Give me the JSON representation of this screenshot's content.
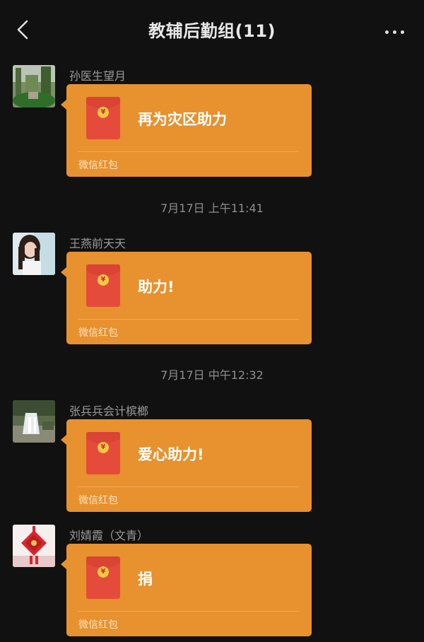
{
  "header": {
    "title": "教辅后勤组(11)",
    "back_icon": "chevron-left-icon",
    "more_icon": "more-horizontal-icon"
  },
  "messages": [
    {
      "sender": "孙医生望月",
      "avatar": "avatar-garden-photo",
      "red_packet": {
        "text": "再为灾区助力",
        "label": "微信红包",
        "coin": "¥"
      }
    },
    {
      "sender": "王燕前天天",
      "avatar": "avatar-girl-photo",
      "red_packet": {
        "text": "助力!",
        "label": "微信红包",
        "coin": "¥"
      }
    },
    {
      "sender": "张兵兵会计槟榔",
      "avatar": "avatar-waterfall-photo",
      "red_packet": {
        "text": "爱心助力!",
        "label": "微信红包",
        "coin": "¥"
      }
    },
    {
      "sender": "刘婧霞（文青）",
      "avatar": "avatar-chinese-knot-photo",
      "red_packet": {
        "text": "捐",
        "label": "微信红包",
        "coin": "¥"
      }
    }
  ],
  "timestamps": [
    "7月17日 上午11:41",
    "7月17日 中午12:32"
  ],
  "colors": {
    "background": "#111111",
    "bubble": "#e8912f",
    "envelope": "#e54b3a",
    "coin": "#f6c744"
  }
}
